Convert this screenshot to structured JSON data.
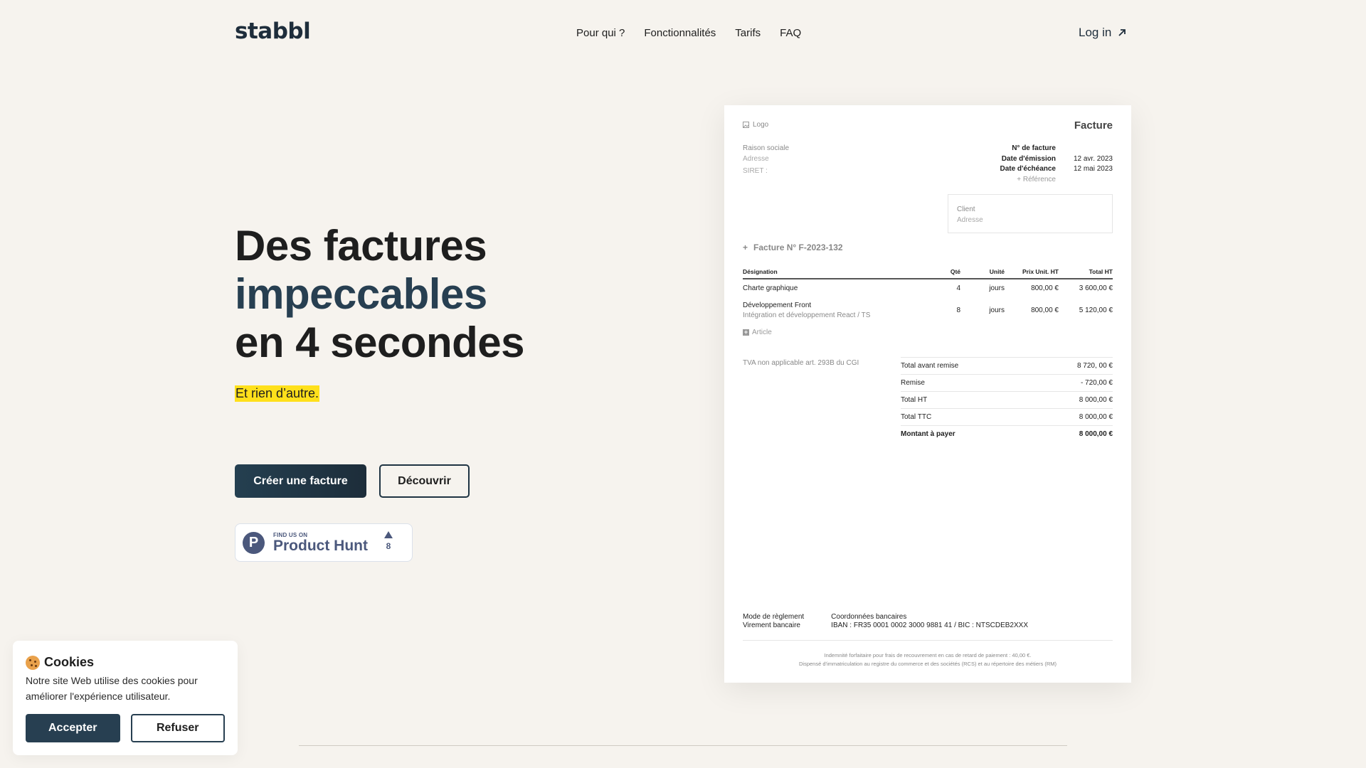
{
  "header": {
    "logo": "stabbl",
    "nav": [
      "Pour qui ?",
      "Fonctionnalités",
      "Tarifs",
      "FAQ"
    ],
    "login": "Log in"
  },
  "hero": {
    "line1": "Des factures",
    "line2": "impeccables",
    "line3": "en 4 secondes",
    "tagline": "Et rien d’autre.",
    "primary_cta": "Créer une facture",
    "secondary_cta": "Découvrir"
  },
  "product_hunt": {
    "small": "FIND US ON",
    "big": "Product Hunt",
    "votes": "8"
  },
  "cookie": {
    "title": "Cookies",
    "text": "Notre site Web utilise des cookies pour améliorer l'expérience utilisateur.",
    "accept": "Accepter",
    "refuse": "Refuser"
  },
  "invoice": {
    "logo": "Logo",
    "title": "Facture",
    "company_name": "Raison sociale",
    "company_address": "Adresse",
    "siret": "SIRET :",
    "meta": [
      {
        "label": "N° de facture",
        "value": ""
      },
      {
        "label": "Date d'émission",
        "value": "12 avr. 2023"
      },
      {
        "label": "Date d'échéance",
        "value": "12 mai 2023"
      }
    ],
    "reference": "+ Référence",
    "client_label": "Client",
    "client_address": "Adresse",
    "number": "Facture N° F-2023-132",
    "columns": [
      "Désignation",
      "Qté",
      "Unité",
      "Prix Unit. HT",
      "Total HT"
    ],
    "rows": [
      {
        "designation": "Charte graphique",
        "detail": "",
        "qty": "4",
        "unit": "jours",
        "price": "800,00 €",
        "total": "3 600,00 €"
      },
      {
        "designation": "Développement Front",
        "detail": "Intégration et développement React / TS",
        "qty": "8",
        "unit": "jours",
        "price": "800,00 €",
        "total": "5 120,00 €"
      }
    ],
    "add_article": "Article",
    "tva_note": "TVA non applicable art. 293B du CGI",
    "totals": [
      {
        "label": "Total avant remise",
        "value": "8 720, 00 €"
      },
      {
        "label": "Remise",
        "value": "- 720,00 €"
      },
      {
        "label": "Total HT",
        "value": "8 000,00 €"
      },
      {
        "label": "Total TTC",
        "value": "8 000,00 €"
      },
      {
        "label": "Montant à payer",
        "value": "8 000,00 €"
      }
    ],
    "payment_mode_label": "Mode de règlement",
    "payment_mode": "Virement bancaire",
    "bank_label": "Coordonnées bancaires",
    "bank": "IBAN : FR35 0001 0002 3000 9881 41 / BIC : NTSCDEB2XXX",
    "legal1": "Indemnité forfaitaire pour frais de recouvrement en cas de retard de paiement : 40,00 €.",
    "legal2": "Dispensé d'immatriculation au registre du commerce et des sociétés (RCS) et au répertoire des métiers (RM)"
  }
}
